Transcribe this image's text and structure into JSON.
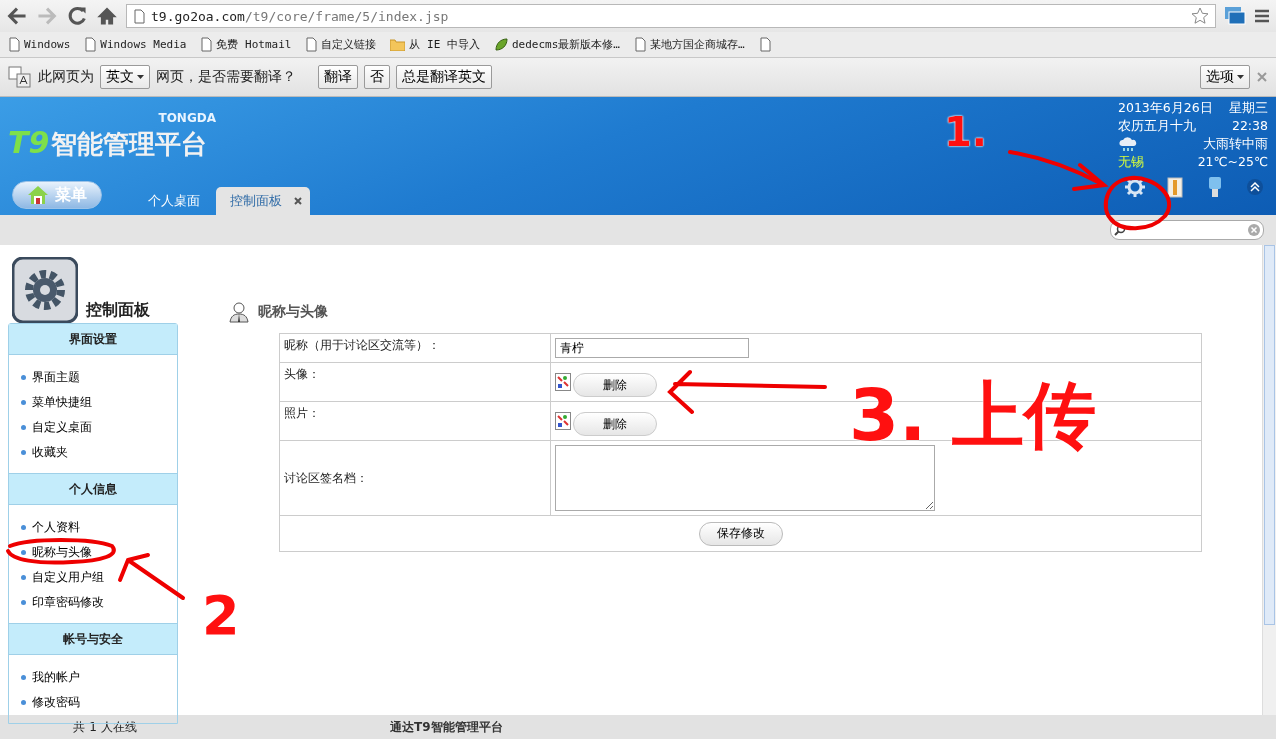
{
  "browser": {
    "url_host": "t9.go2oa.com",
    "url_path": "/t9/core/frame/5/index.jsp",
    "bookmarks": [
      {
        "label": "Windows",
        "kind": "page"
      },
      {
        "label": "Windows Media",
        "kind": "page"
      },
      {
        "label": "免费 Hotmail",
        "kind": "page"
      },
      {
        "label": "自定义链接",
        "kind": "page"
      },
      {
        "label": "从 IE 中导入",
        "kind": "folder"
      },
      {
        "label": "dedecms最新版本修…",
        "kind": "leaf"
      },
      {
        "label": "某地方国企商城存…",
        "kind": "page"
      },
      {
        "kind": "page"
      }
    ],
    "translate_bar": {
      "prefix": "此网页为",
      "language": "英文",
      "question": "网页，是否需要翻译？",
      "buttons": [
        "翻译",
        "否",
        "总是翻译英文"
      ],
      "options": "选项"
    }
  },
  "header": {
    "brand_small": "TONGDA",
    "brand_t9": "T9",
    "brand_name": "智能管理平台",
    "menu_button": "菜单",
    "tabs": [
      {
        "label": "个人桌面",
        "selected": false
      },
      {
        "label": "控制面板",
        "selected": true
      }
    ],
    "date": "2013年6月26日",
    "weekday": "星期三",
    "lunar": "农历五月十九",
    "time": "22:38",
    "weather": "大雨转中雨",
    "city": "无锡",
    "temperature": "21℃~25℃"
  },
  "sidebar": {
    "title": "控制面板",
    "sections": [
      {
        "title": "界面设置",
        "items": [
          {
            "label": "界面主题"
          },
          {
            "label": "菜单快捷组"
          },
          {
            "label": "自定义桌面"
          },
          {
            "label": "收藏夹"
          }
        ]
      },
      {
        "title": "个人信息",
        "items": [
          {
            "label": "个人资料"
          },
          {
            "label": "昵称与头像"
          },
          {
            "label": "自定义用户组"
          },
          {
            "label": "印章密码修改"
          }
        ]
      },
      {
        "title": "帐号与安全",
        "items": [
          {
            "label": "我的帐户"
          },
          {
            "label": "修改密码"
          }
        ]
      }
    ]
  },
  "content": {
    "title": "昵称与头像",
    "rows": [
      {
        "kind": "text",
        "label": "昵称（用于讨论区交流等）：",
        "value": "青柠"
      },
      {
        "kind": "image",
        "label": "头像：",
        "button": "删除"
      },
      {
        "kind": "image",
        "label": "照片：",
        "button": "删除"
      },
      {
        "kind": "textarea",
        "label": "讨论区签名档："
      }
    ],
    "save_button": "保存修改"
  },
  "status_bar": {
    "online": "共 1 人在线",
    "product": "通达T9智能管理平台"
  },
  "annotations": [
    {
      "kind": "step",
      "label": "1."
    },
    {
      "kind": "step",
      "label": "2"
    },
    {
      "kind": "step",
      "label": "3. 上传"
    }
  ]
}
